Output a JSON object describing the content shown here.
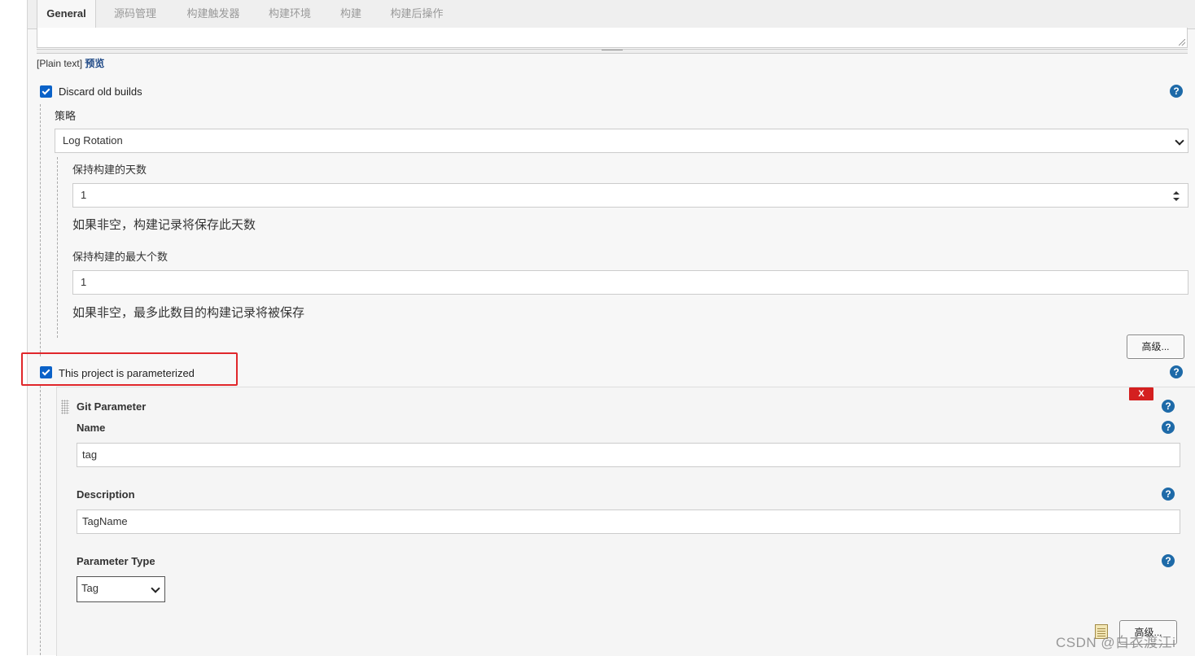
{
  "tabs": [
    {
      "label": "General",
      "active": true
    },
    {
      "label": "源码管理",
      "active": false
    },
    {
      "label": "构建触发器",
      "active": false
    },
    {
      "label": "构建环境",
      "active": false
    },
    {
      "label": "构建",
      "active": false
    },
    {
      "label": "构建后操作",
      "active": false
    }
  ],
  "description": {
    "format_text": "[Plain text]",
    "preview_link": "预览"
  },
  "discard_old_builds": {
    "label": "Discard old builds",
    "checked": true,
    "strategy_label": "策略",
    "strategy_value": "Log Rotation",
    "days_label": "保持构建的天数",
    "days_value": "1",
    "days_hint": "如果非空，构建记录将保存此天数",
    "max_label": "保持构建的最大个数",
    "max_value": "1",
    "max_hint": "如果非空，最多此数目的构建记录将被保存",
    "advanced_button": "高级..."
  },
  "parameterized": {
    "label": "This project is parameterized",
    "checked": true,
    "highlight_color": "#e0272b"
  },
  "git_parameter": {
    "title": "Git Parameter",
    "delete_button": "X",
    "name_label": "Name",
    "name_value": "tag",
    "description_label": "Description",
    "description_value": "TagName",
    "type_label": "Parameter Type",
    "type_value": "Tag",
    "advanced_button": "高级..."
  },
  "help_symbol": "?",
  "watermark": "CSDN @白衣渡江i",
  "colors": {
    "checkbox": "#0b62c8",
    "help_icon": "#1e6aa8",
    "delete_button": "#d42020",
    "link": "#204a87"
  }
}
